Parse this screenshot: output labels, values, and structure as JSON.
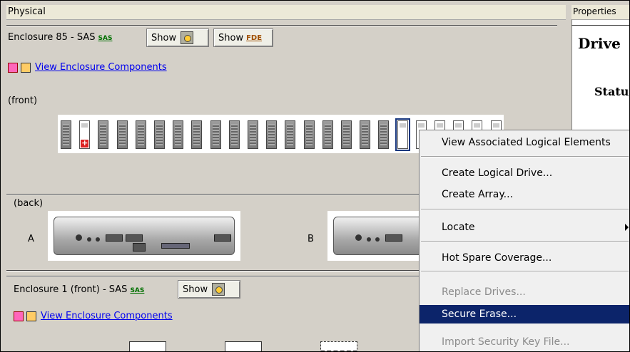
{
  "left_panel": {
    "title": "Physical"
  },
  "right_panel": {
    "title": "Properties",
    "heading": "Drive",
    "status_label": "Statu"
  },
  "enclosure85": {
    "label": "Enclosure 85 - SAS",
    "sas_badge": "SAS",
    "show_label": "Show",
    "show_fde_label": "Show",
    "fde_badge": "FDE",
    "view_components_link": "View Enclosure Components",
    "front_label": "(front)",
    "back_label": "(back)",
    "controller_a": "A",
    "controller_b": "B",
    "drive_slots": [
      "full",
      "fault",
      "full",
      "full",
      "full",
      "full",
      "full",
      "full",
      "full",
      "full",
      "full",
      "full",
      "full",
      "full",
      "full",
      "full",
      "full",
      "full",
      "selected",
      "empty",
      "empty",
      "empty",
      "empty",
      "empty"
    ]
  },
  "enclosure1": {
    "label": "Enclosure 1 (front) - SAS",
    "sas_badge": "SAS",
    "show_label": "Show",
    "view_components_link": "View Enclosure Components"
  },
  "context_menu": {
    "items": [
      {
        "label": "View Associated Logical Elements",
        "enabled": true
      },
      {
        "label": "Create Logical Drive...",
        "enabled": true
      },
      {
        "label": "Create Array...",
        "enabled": true
      },
      {
        "label": "Locate",
        "enabled": true,
        "submenu": true
      },
      {
        "label": "Hot Spare Coverage...",
        "enabled": true
      },
      {
        "label": "Replace Drives...",
        "enabled": false
      },
      {
        "label": "Secure Erase...",
        "enabled": true,
        "highlighted": true
      },
      {
        "label": "Import Security Key File...",
        "enabled": false
      }
    ]
  },
  "colors": {
    "menu_highlight": "#0c246a",
    "panel_bg": "#d4d0c8",
    "link": "#0000ee",
    "fault": "#dd2222"
  }
}
